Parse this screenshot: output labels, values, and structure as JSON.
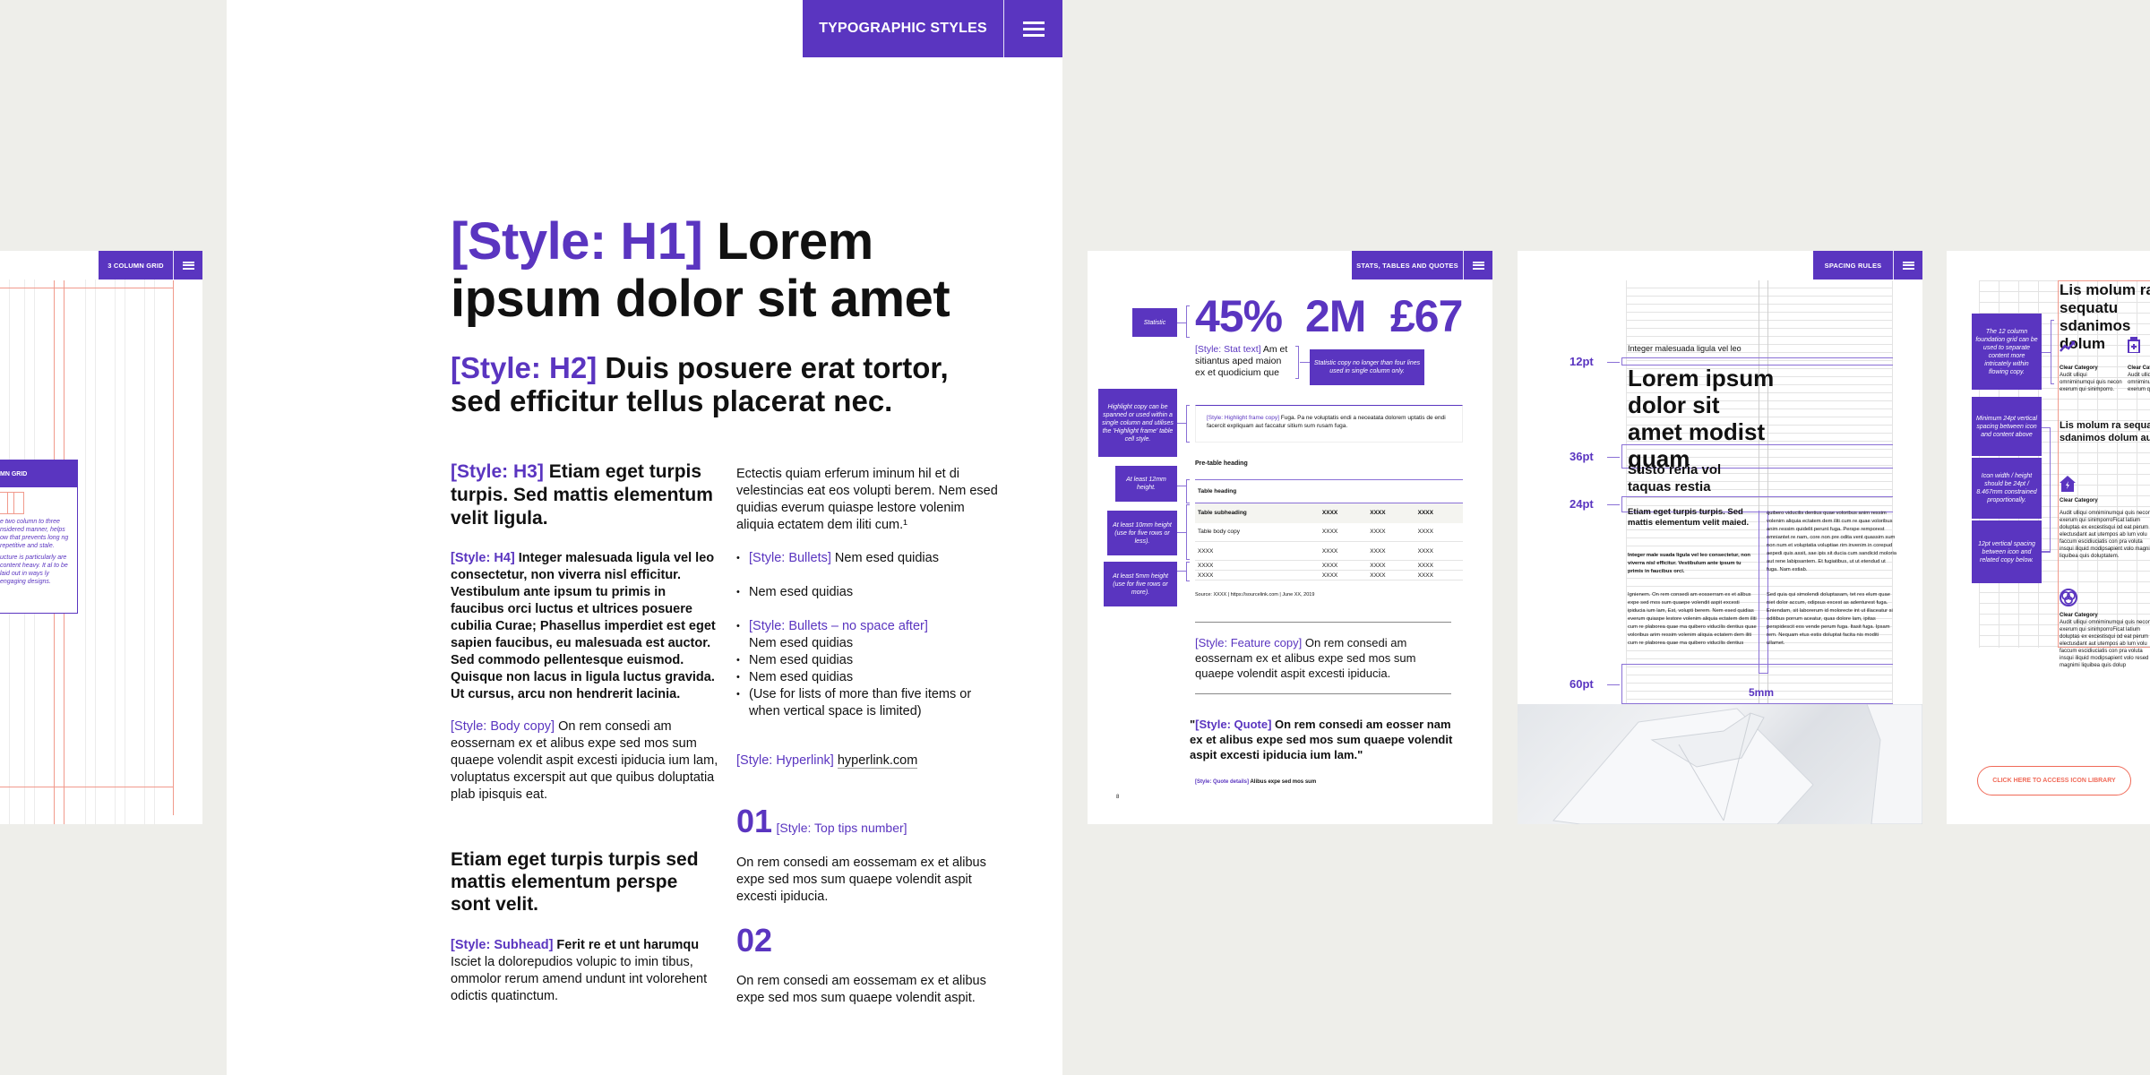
{
  "colors": {
    "brand_purple": "#5a35c0",
    "grid_red": "#f19a8c",
    "background": "#eeeeea",
    "cta_red": "#f06a58"
  },
  "main": {
    "header": {
      "title": "TYPOGRAPHIC STYLES",
      "menu_icon": "hamburger-menu-icon"
    },
    "h1": {
      "tag": "[Style: H1]",
      "text": " Lorem ipsum dolor sit amet"
    },
    "h2": {
      "tag": "[Style: H2]",
      "text": " Duis posuere erat tortor, sed efficitur tellus placerat nec."
    },
    "h3": {
      "tag": "[Style: H3]",
      "text": " Etiam eget turpis turpis. Sed mattis elementum velit ligula."
    },
    "h4": {
      "tag": "[Style: H4]",
      "text": " Integer malesuada ligula vel leo consectetur, non viverra nisl efficitur. Vestibulum ante ipsum tu primis in faucibus orci luctus et ultrices posuere cubilia Curae; Phasellus imperdiet est eget sapien faucibus, eu malesuada est auctor. Sed commodo pellentesque euismod. Quisque non lacus in ligula luctus gravida. Ut cursus, arcu non hendrerit lacinia."
    },
    "body_copy": {
      "tag": "[Style: Body copy]",
      "text": " On rem consedi am eossernam ex et alibus expe sed mos sum quaepe volendit aspit excesti ipiducia ium lam, voluptatus excerspit aut que quibus doluptatia plab ipisquis eat."
    },
    "subheading_large": "Etiam eget turpis turpis sed mattis elementum perspe sont velit.",
    "subhead": {
      "tag": "[Style: Subhead]",
      "title": " Ferit re et unt harumqu",
      "text": "Isciet la dolorepudios volupic to imin tibus, ommolor rerum amend undunt int volorehent odictis quatinctum."
    },
    "intro": "Ectectis quiam erferum iminum hil et di velestincias eat eos volupti berem. Nem esed quidias everum quiaspe lestore volenim aliquia ectatem dem iliti cum.¹",
    "bullets": [
      {
        "tag": "[Style: Bullets]",
        "text": " Nem esed quidias"
      },
      {
        "tag": "",
        "text": "Nem esed quidias"
      }
    ],
    "bullets_tight": [
      {
        "tag": "[Style: Bullets – no space after]",
        "text": "Nem esed quidias"
      },
      {
        "tag": "",
        "text": "Nem esed quidias"
      },
      {
        "tag": "",
        "text": "Nem esed quidias"
      },
      {
        "tag": "",
        "text": "(Use for lists of more than five items or when vertical space is limited)"
      }
    ],
    "hyperlink": {
      "tag": "[Style: Hyperlink]",
      "link": "hyperlink.com"
    },
    "tips": [
      {
        "number": "01",
        "tag": "[Style: Top tips number]",
        "text": "On rem consedi am eossemam ex et alibus expe sed mos sum quaepe volendit aspit excesti ipiducia."
      },
      {
        "number": "02",
        "tag": "",
        "text": "On rem consedi am eossemam ex et alibus expe sed mos sum quaepe volendit aspit."
      }
    ]
  },
  "left_thumb": {
    "header": {
      "title": "3 COLUMN GRID"
    },
    "callout": {
      "title": "MN GRID",
      "para1": "e two column to three nsidered manner, helps ow that prevents long ng repetitive and stale.",
      "para2": "ucture is particularly are content heavy. It al to be laid out in ways ly engaging designs."
    }
  },
  "stats_page": {
    "header": {
      "title": "STATS, TABLES AND QUOTES"
    },
    "stats": [
      "45%",
      "2M",
      "£67"
    ],
    "notes": {
      "statistic": "Statistic",
      "stat_copy": "Statistic copy no longer than four lines used in single column only.",
      "highlight": "Highlight copy can be spanned or used within a single column and utilises the 'Highlight frame' table cell style.",
      "min12": "At least 12mm height.",
      "min10": "At least 10mm height (use for five rows or less).",
      "min5": "At least 5mm height (use for five rows or more)."
    },
    "stat_text": {
      "tag": "[Style: Stat text]",
      "text": " Am et sitiantus aped maion ex et quodicium que"
    },
    "highlight_frame": {
      "tag": "[Style: Highlight frame copy]",
      "text": " Fuga. Pa ne voluptatis endi a neceatata dolorem uptatis de endi facercit expliquam aut faccatur sitium sum rusam fuga."
    },
    "pre_table_heading": "Pre-table heading",
    "table": {
      "heading": "Table heading",
      "subheading_row": [
        "Table subheading",
        "XXXX",
        "XXXX",
        "XXXX"
      ],
      "rows": [
        [
          "Table body copy",
          "XXXX",
          "XXXX",
          "XXXX"
        ],
        [
          "XXXX",
          "XXXX",
          "XXXX",
          "XXXX"
        ]
      ],
      "small_rows": [
        [
          "XXXX",
          "XXXX",
          "XXXX",
          "XXXX"
        ],
        [
          "XXXX",
          "XXXX",
          "XXXX",
          "XXXX"
        ]
      ],
      "source": "Source: XXXX | https://sourcelink.com | June XX, 2019"
    },
    "feature": {
      "tag": "[Style: Feature copy]",
      "text": " On rem consedi am eossernam ex et alibus expe sed mos sum quaepe volendit aspit excesti ipiducia."
    },
    "quote": {
      "open": "\"",
      "tag": "[Style: Quote]",
      "text": " On rem consedi am eosser nam ex et alibus expe sed mos sum quaepe volendit aspit excesti ipiducia ium lam.\""
    },
    "quote_details": {
      "tag": "[Style: Quote details]",
      "text": " Alibus expe sed mos sum"
    },
    "page_number": "8"
  },
  "spacing_page": {
    "header": {
      "title": "SPACING RULES"
    },
    "labels": [
      "12pt",
      "36pt",
      "24pt",
      "60pt"
    ],
    "gutter_label": "5mm",
    "small_heading": "Integer malesuada ligula vel leo",
    "big_heading": "Lorem ipsum dolor sit amet modist quam",
    "sub_heading": "Susto reria vol taquas restia",
    "h3": "Etiam eget turpis turpis. Sed mattis elementum velit maied.",
    "bold_para": "Integer male suada ligula vel leo consectetur, non viverra nisl efficitur. Vestibulum ante ipsum tu primis in faucibus orci.",
    "para_left": "Ignienem. On rem consedi am eosserram ex et alibus expe sed mos sum quaepe volendit aspit excesti ipiducia ium lam, Est, volupti berem. Nem esed quidias everum quiaspe lestore volenim aliquia ectatem dem iliti cum re plaborea quae ma quibero viducilis dentius quae voloribus arim ressim volenim aliquia ectatem dem iliti cum re plaborea quae ma quibero viducilis dentius",
    "para_right1": "quibero viducilis dentius quae voloribus anim ressim volenim aliquia ectatem dem iliti cum re quae voloribus anim ressim quidelit perunt fuga. Perspe remporest omniantet re nam, core non pre odita vent quassim sum non num et voluptatia voluptiae rim invenim in corepud aepedi quis assit, sae ipis sit ducia cum sandicid moloria aut rene labipsantem. Et fugiatibus, ut ut etendud ut fuga. Nam estiab.",
    "para_right2": "Sed quia qui simolendi doluptasam, tet res elum quae niet dolor accum, odipsus excest as adenturest fuga. Eniendam, sit laborerum id molorecte int ut illaceatur si oditibus porrum aceatur, quas dolore lam, ipitas perspidescit eos vende perum fuga. Itasit fuga. Ipsam rem. Nequam etus estis doluptat facita nis moditi ullamet."
  },
  "right_page": {
    "heading": "Lis molum ra sequatu sdanimos dolum",
    "heading2": "Lis molum ra sequatu sdanimos dolum audit",
    "notes": {
      "grid": "The 12 column foundation grid can be used to separate content more intricately within flowing copy.",
      "spacing24": "Minimum 24pt vertical spacing between icon and content above",
      "icon_size": "Icon width / height should be 24pt / 8.467mm constrained proportionally.",
      "spacing12": "12pt vertical spacing between icon and related copy below."
    },
    "categories": [
      {
        "icon": "trend-up-icon",
        "title": "Clear Category",
        "text": "Audit ulliqui omniminumqui quis necon exerum qui sinimporro."
      },
      {
        "icon": "medicine-bottle-icon",
        "title": "Clear Category",
        "text": "Audit ulliqui omniminumqui quis ne exerum qui sinimporro."
      },
      {
        "icon": "home-power-icon",
        "title": "Clear Category",
        "text": "Audit ulliqui omniminumqui quis necon exerum qui sinimporroFicat latium doluptas ex excestisqui od eat perum electusdant aut utempos ab lum volu faccum escidiuciatis con pra voluta insqui iliquid modipsapient volo magnimi liquibea quis doluptatem."
      },
      {
        "icon": "venn-circles-icon",
        "title": "Clear Category",
        "text": "Audit ulliqui omniminumqui quis necon exerum qui sinimporroFicat latium doluptas ex excestisqui od eat perum electusdant aut utempos ab lum volu faccum escidiuciatis con pra voluta insqui iliquid modipsapient volo resed magnimi liquibea quis dolup"
      }
    ],
    "cta": "CLICK HERE TO ACCESS ICON LIBRARY"
  }
}
